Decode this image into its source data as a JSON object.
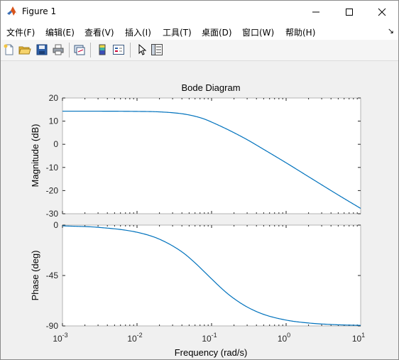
{
  "window": {
    "title": "Figure 1"
  },
  "menu": [
    "文件(F)",
    "编辑(E)",
    "查看(V)",
    "插入(I)",
    "工具(T)",
    "桌面(D)",
    "窗口(W)",
    "帮助(H)"
  ],
  "toolbar": {
    "buttons": [
      "new-figure",
      "open-file",
      "save",
      "print",
      "link-plot",
      "insert-colorbar",
      "insert-legend",
      "edit-plot",
      "property-inspector"
    ]
  },
  "colors": {
    "line": "#0072bd",
    "axes_bg": "#ffffff",
    "figure_bg": "#f0f0f0"
  },
  "chart_data": [
    {
      "type": "line",
      "title": "Bode Diagram",
      "xlabel": "",
      "ylabel": "Magnitude (dB)",
      "xscale": "log",
      "xlim": [
        0.001,
        10
      ],
      "ylim": [
        -30,
        20
      ],
      "yticks": [
        "20",
        "10",
        "0",
        "-10",
        "-20",
        "-30"
      ],
      "series": [
        {
          "x": [
            0.001,
            0.003,
            0.01,
            0.02,
            0.04,
            0.06,
            0.08,
            0.1,
            0.15,
            0.2,
            0.3,
            0.5,
            1,
            2,
            5,
            10
          ],
          "values": [
            14.3,
            14.3,
            14.2,
            14.0,
            13.2,
            12.1,
            10.9,
            9.6,
            7.0,
            5.0,
            2.0,
            -2.2,
            -8.0,
            -14.0,
            -21.9,
            -27.7
          ]
        }
      ]
    },
    {
      "type": "line",
      "xlabel": "Frequency  (rad/s)",
      "ylabel": "Phase (deg)",
      "xscale": "log",
      "xlim": [
        0.001,
        10
      ],
      "ylim": [
        -90,
        0
      ],
      "yticks": [
        "0",
        "-45",
        "-90"
      ],
      "xticks": [
        "-3",
        "-2",
        "-1",
        "0",
        "1"
      ],
      "series": [
        {
          "x": [
            0.001,
            0.003,
            0.01,
            0.02,
            0.04,
            0.06,
            0.08,
            0.1,
            0.15,
            0.2,
            0.3,
            0.5,
            1,
            2,
            5,
            10
          ],
          "values": [
            -0.7,
            -2.0,
            -6.4,
            -12.6,
            -23.9,
            -33.7,
            -41.7,
            -48.0,
            -59.0,
            -65.6,
            -73.1,
            -79.7,
            -84.8,
            -87.4,
            -89.0,
            -89.5
          ]
        }
      ]
    }
  ]
}
